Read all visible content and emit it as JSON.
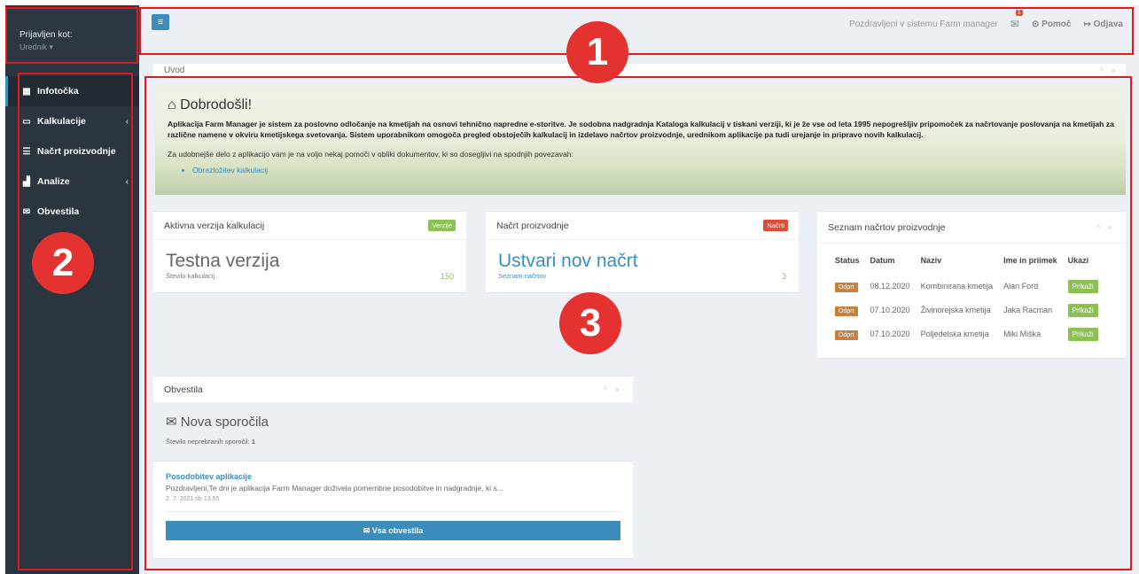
{
  "sidebar": {
    "logged_label": "Prijavljen kot:",
    "role": "Urednik ▾",
    "items": [
      {
        "label": "Infotočka",
        "icon": "dashboard-icon",
        "active": true
      },
      {
        "label": "Kalkulacije",
        "icon": "desktop-icon",
        "has_children": true
      },
      {
        "label": "Načrt proizvodnje",
        "icon": "list-icon"
      },
      {
        "label": "Analize",
        "icon": "bar-chart-icon",
        "has_children": true
      },
      {
        "label": "Obvestila",
        "icon": "envelope-icon"
      }
    ]
  },
  "topbar": {
    "menu_icon": "≡",
    "welcome": "Pozdravljeni v sistemu Farm manager",
    "mail_count": "1",
    "help": "Pomoč",
    "logout": "Odjava"
  },
  "uvod": {
    "title": "Uvod"
  },
  "hero": {
    "title": "Dobrodošli!",
    "lead": "Aplikacija Farm Manager je sistem za poslovno odločanje na kmetijah na osnovi tehnično napredne e-storitve. Je sodobna nadgradnja Kataloga kalkulacij v tiskani verziji, ki je že vse od leta 1995 nepogrešljiv pripomoček za načrtovanje poslovanja na kmetijah za različne namene v okviru kmetijskega svetovanja. Sistem uporabnikom omogoča pregled obstoječih kalkulacij in izdelavo načrtov proizvodnje, urednikom aplikacije pa tudi urejanje in pripravo novih kalkulacij.",
    "sub": "Za udobnejše delo z aplikacijo vam je na voljo nekaj pomoči v obliki dokumentov, ki so dosegljivi na spodnjih povezavah:",
    "link": "Obrazložitev kalkulacij"
  },
  "active_version": {
    "title": "Aktivna verzija kalkulacij",
    "badge": "Verzije",
    "name": "Testna verzija",
    "count_label": "Število kalkulacij",
    "count": "150"
  },
  "plan": {
    "title": "Načrt proizvodnje",
    "badge": "Načrti",
    "action": "Ustvari nov načrt",
    "link": "Seznam načrtov",
    "count": "3"
  },
  "plan_list": {
    "title": "Seznam načrtov proizvodnje",
    "headers": [
      "Status",
      "Datum",
      "Naziv",
      "Ime in priimek",
      "Ukazi"
    ],
    "rows": [
      {
        "status": "Odprt",
        "date": "08.12.2020",
        "name": "Kombinirana kmetija",
        "person": "Alan Ford",
        "action": "Prikaži"
      },
      {
        "status": "Odprt",
        "date": "07.10.2020",
        "name": "Živinorejska kmetija",
        "person": "Jaka Racman",
        "action": "Prikaži"
      },
      {
        "status": "Odprt",
        "date": "07.10.2020",
        "name": "Poljedelska kmetija",
        "person": "Miki Miška",
        "action": "Prikaži"
      }
    ]
  },
  "notices": {
    "title": "Obvestila",
    "new_title": "Nova sporočila",
    "unread_label": "Število neprebranih sporočil:",
    "unread_count": "1",
    "item_title": "Posodobitev aplikacije",
    "item_text": "Pozdravljeni,Te dni je aplikacija Farm Manager doživela pomembne posodobitve in nadgradnje, ki s...",
    "item_date": "2. 7. 2021 ob 13:55",
    "all_button": "Vsa obvestila"
  },
  "annotations": [
    "1",
    "2",
    "3"
  ]
}
